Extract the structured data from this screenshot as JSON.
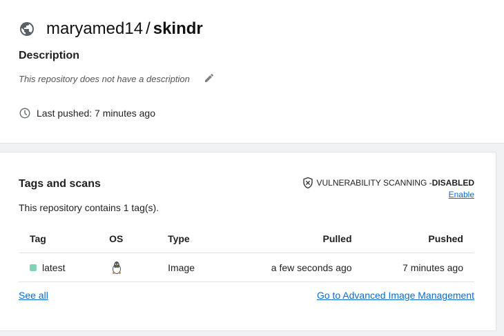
{
  "repo": {
    "namespace": "maryamed14",
    "separator": "/",
    "name": "skindr"
  },
  "description": {
    "heading": "Description",
    "text": "This repository does not have a description"
  },
  "last_pushed": "Last pushed: 7 minutes ago",
  "tags_card": {
    "title": "Tags and scans",
    "vuln_label": "VULNERABILITY SCANNING - ",
    "vuln_state": "DISABLED",
    "enable_label": "Enable",
    "contains_text": "This repository contains 1 tag(s).",
    "columns": {
      "tag": "Tag",
      "os": "OS",
      "type": "Type",
      "pulled": "Pulled",
      "pushed": "Pushed"
    },
    "rows": [
      {
        "tag": "latest",
        "os_icon": "linux-icon",
        "type": "Image",
        "pulled": "a few seconds ago",
        "pushed": "7 minutes ago"
      }
    ],
    "see_all_label": "See all",
    "advanced_label": "Go to Advanced Image Management"
  },
  "colors": {
    "link": "#0b6bcb",
    "tag_status": "#7fd3b6"
  }
}
